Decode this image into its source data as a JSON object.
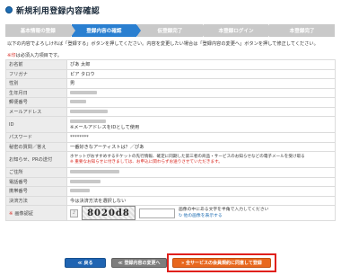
{
  "page": {
    "title": "新規利用登録内容確認"
  },
  "steps": [
    {
      "label": "基本情報の登録",
      "active": false
    },
    {
      "label": "登録内容の確認",
      "active": true
    },
    {
      "label": "仮登録完了",
      "active": false
    },
    {
      "label": "本登録ログイン",
      "active": false
    },
    {
      "label": "本登録完了",
      "active": false
    }
  ],
  "intro": "以下の内容でよろしければ「登録する」ボタンを押してください。内容を変更したい場合は「登録内容の変更へ」ボタンを押して修正してください。",
  "required_note": {
    "mark": "※印",
    "text": "は必須入力項目です。"
  },
  "form": {
    "rows": [
      {
        "label": "お名前",
        "value": "ぴあ 太郎"
      },
      {
        "label": "フリガナ",
        "value": "ピア タロウ"
      },
      {
        "label": "性別",
        "value": "男"
      },
      {
        "label": "生年月日",
        "value": ""
      },
      {
        "label": "郵便番号",
        "value": ""
      },
      {
        "label": "メールアドレス",
        "value": ""
      },
      {
        "label": "ID",
        "value": "",
        "sub": "※メールアドレスをIDとして使用"
      },
      {
        "label": "パスワード",
        "value": "********"
      },
      {
        "label": "秘密の質問／答え",
        "value": "一番好きなアーティストは？／ぴあ"
      },
      {
        "label": "お知らせ、PRの送付",
        "value": "ホヤットがおすすめするチケットの先行情報、確定に同期した第三者の商品・サービスのお知らせなどの電子メールを受け取る",
        "note": "※ 重要なお知らせに付きましては、お申込に関わらずお送りさせていただきます。"
      },
      {
        "label": "ご住所",
        "value": ""
      },
      {
        "label": "電話番号",
        "value": ""
      },
      {
        "label": "携帯番号",
        "value": ""
      },
      {
        "label": "決済方法",
        "value": "今は決済方法を選択しない"
      }
    ],
    "captcha": {
      "label": "画像認証",
      "code": "8020d8",
      "hint1": "画像の中にある文字を半角で入力してください",
      "hint2": "↻ 他の画像を表示する"
    }
  },
  "buttons": {
    "back": "≪ 戻る",
    "edit": "≪ 登録内容の変更へ",
    "submit": "» 全サービスの会員規約に同意して登録"
  }
}
